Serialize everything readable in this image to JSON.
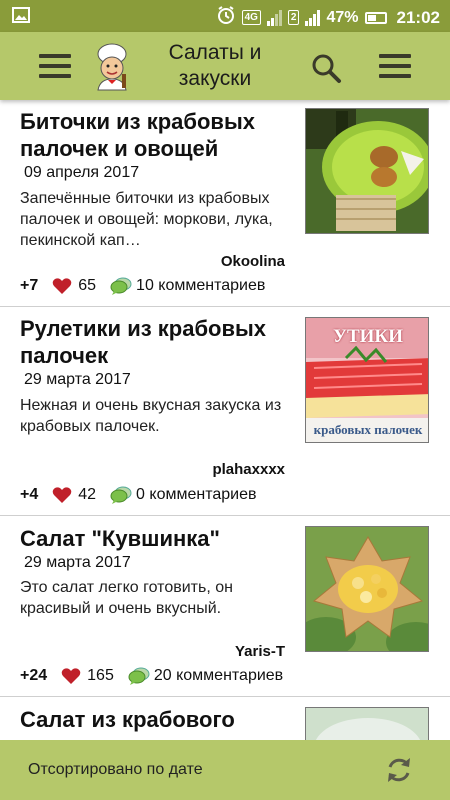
{
  "status_bar": {
    "network_badge": "4G",
    "sim_badge": "2",
    "battery_percent": "47%",
    "time": "21:02"
  },
  "app_bar": {
    "title": "Салаты и закуски",
    "icons": [
      "menu-icon",
      "chef-logo",
      "search-icon",
      "menu-icon"
    ]
  },
  "recipes": [
    {
      "title": "Биточки из крабовых палочек и овощей",
      "date": "09 апреля 2017",
      "description": "Запечённые биточки из крабовых палочек и овощей: моркови, лука, пекинской кап…",
      "author": "Okoolina",
      "votes": "+7",
      "likes": "65",
      "comments": "10 комментариев"
    },
    {
      "title": "Рулетики из крабовых палочек",
      "date": "29 марта 2017",
      "description": "Нежная и очень вкусная закуска из крабовых палочек.",
      "author": "plahaxxxx",
      "votes": "+4",
      "likes": "42",
      "comments": "0 комментариев",
      "image_caption_top": "УТИКИ",
      "image_caption_bottom": "крабовых палочек"
    },
    {
      "title": "Салат \"Кувшинка\"",
      "date": "29 марта 2017",
      "description": "Это салат легко готовить, он красивый и очень вкусный.",
      "author": "Yaris-T",
      "votes": "+24",
      "likes": "165",
      "comments": "20 комментариев"
    },
    {
      "title": "Салат из крабового"
    }
  ],
  "bottom_bar": {
    "sort_label": "Отсортировано по дате",
    "icon": "refresh-icon"
  },
  "colors": {
    "status_bar": "#8a9c3a",
    "app_bar": "#b5c86a",
    "heart": "#c0202a",
    "bubble": "#7cc04a"
  }
}
